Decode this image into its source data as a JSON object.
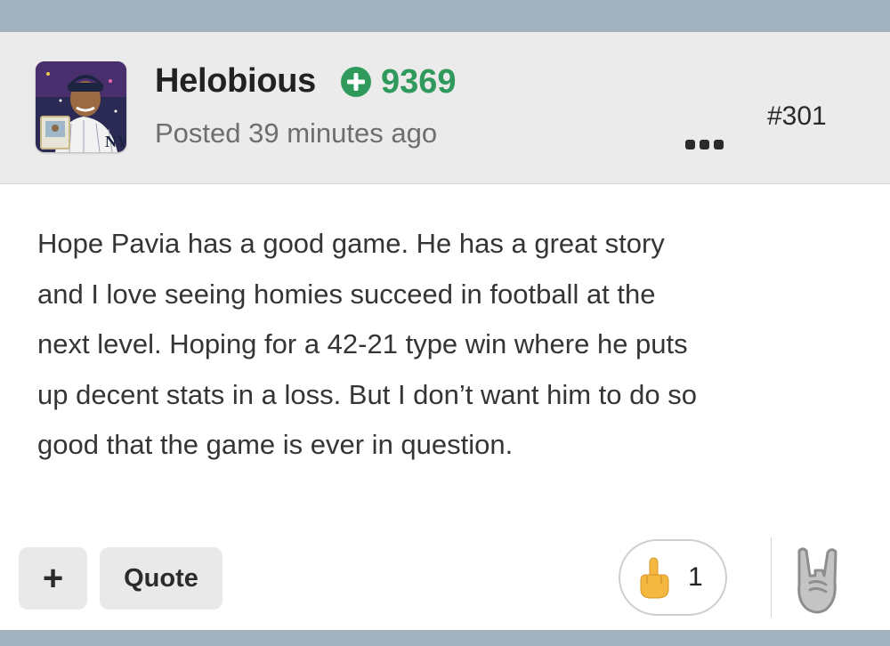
{
  "post": {
    "author": "Helobious",
    "reputation": "9369",
    "posted_time": "Posted 39 minutes ago",
    "post_number": "#301",
    "body_lines": [
      "Hope Pavia has a good game. He has a great story",
      "and I love seeing homies succeed in football at the",
      "next level. Hoping for a 42-21 type win where he puts",
      "up decent stats in a loss. But I don’t want him to do so",
      "good that the game is ever in question."
    ]
  },
  "icons": {
    "reputation": "plus-circle-icon",
    "more": "ellipsis-icon",
    "reaction": "middle-finger-emoji-icon",
    "react": "rock-on-hand-icon"
  },
  "actions": {
    "plus_label": "+",
    "quote_label": "Quote"
  },
  "reaction": {
    "count": "1"
  },
  "colors": {
    "reputation_green": "#2f9a5c",
    "header_bg": "#ebebeb",
    "frame": "#a3b2bf"
  }
}
